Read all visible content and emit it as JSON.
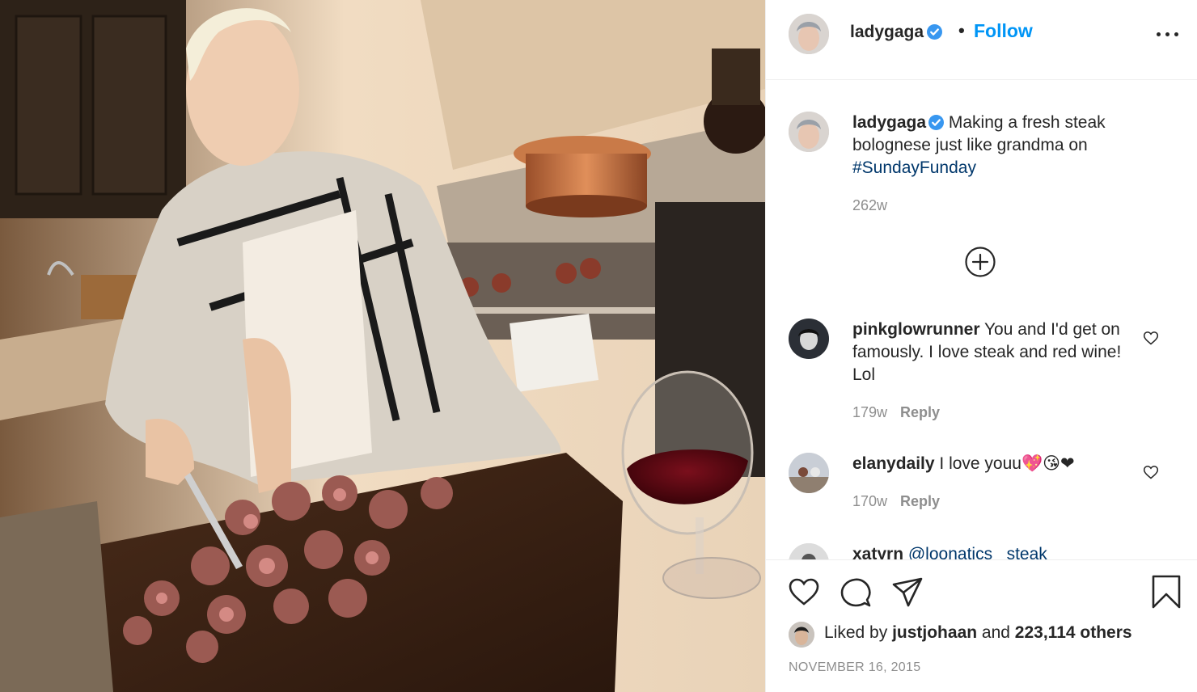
{
  "post": {
    "author": "ladygaga",
    "follow_label": "Follow",
    "separator": "•",
    "caption_text": " Making a fresh steak bolognese just like grandma on ",
    "caption_hashtag": "#SundayFunday",
    "caption_age": "262w",
    "date": "NOVEMBER 16, 2015"
  },
  "comments": [
    {
      "user": "pinkglowrunner",
      "text": " You and I'd get on famously. I love steak and red wine! Lol",
      "age": "179w",
      "reply_label": "Reply"
    },
    {
      "user": "elanydaily",
      "text": " I love youu💖😘❤",
      "age": "170w",
      "reply_label": "Reply"
    },
    {
      "user": "xatyrn",
      "text": " @loonatics_ steak",
      "age": "",
      "reply_label": ""
    }
  ],
  "likes": {
    "prefix": "Liked by ",
    "liker": "justjohaan",
    "middle": " and ",
    "count": "223,114 others"
  },
  "icons": {
    "verified": "verified-badge-icon",
    "more": "more-options-icon",
    "load_more": "plus-circle-icon",
    "like": "heart-icon",
    "comment": "comment-bubble-icon",
    "share": "paper-plane-icon",
    "save": "bookmark-icon"
  },
  "colors": {
    "accent": "#0095f6",
    "verified": "#3897f0",
    "hashtag": "#00376b",
    "muted": "#8e8e8e",
    "text": "#262626"
  }
}
